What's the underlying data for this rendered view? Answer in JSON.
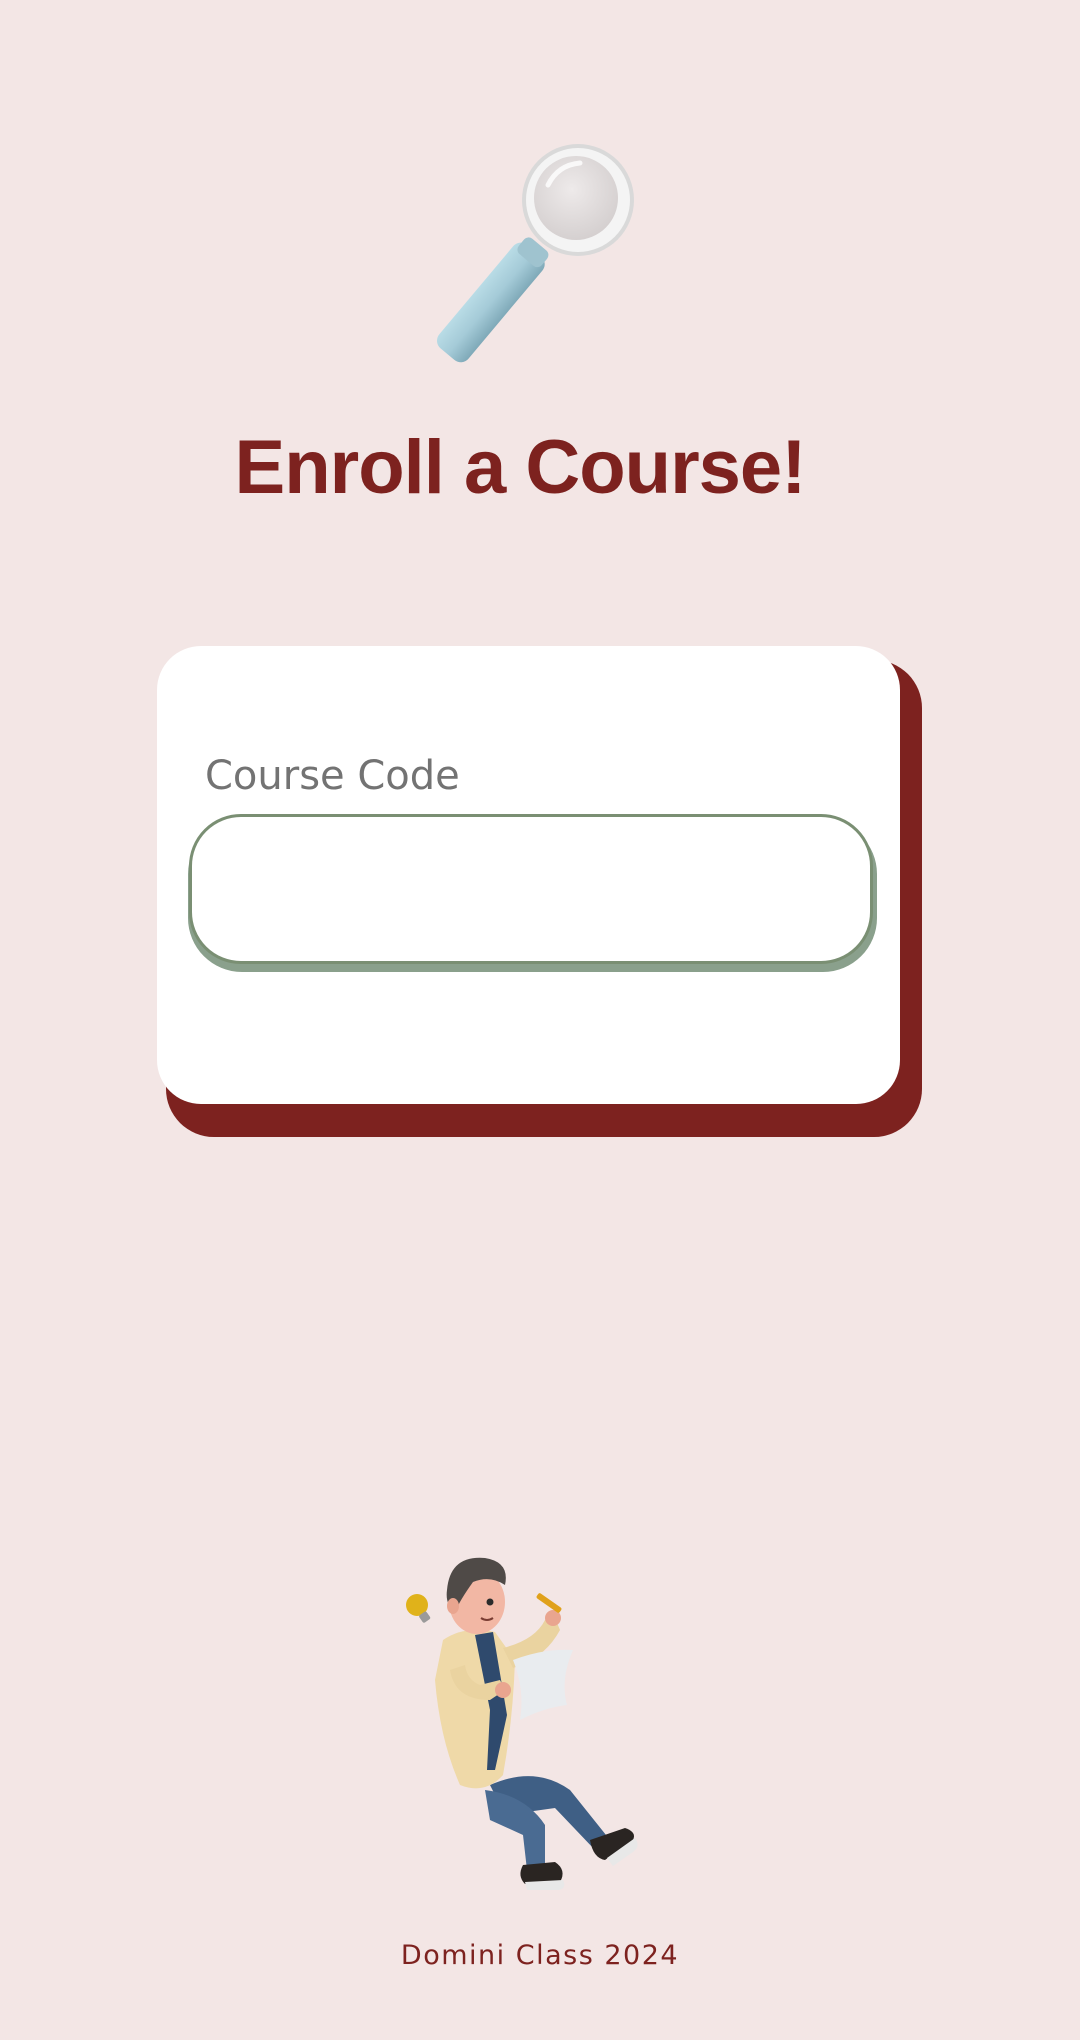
{
  "page": {
    "title": "Enroll a Course!",
    "footer": "Domini Class 2024"
  },
  "form": {
    "course_code_label": "Course Code",
    "course_code_value": ""
  },
  "icons": {
    "top_illustration": "magnifying-glass-icon",
    "bottom_illustration": "person-with-paper-illustration"
  },
  "colors": {
    "background": "#f3e6e5",
    "accent": "#7d221f",
    "input_border": "#7a8f73",
    "label": "#737373"
  }
}
